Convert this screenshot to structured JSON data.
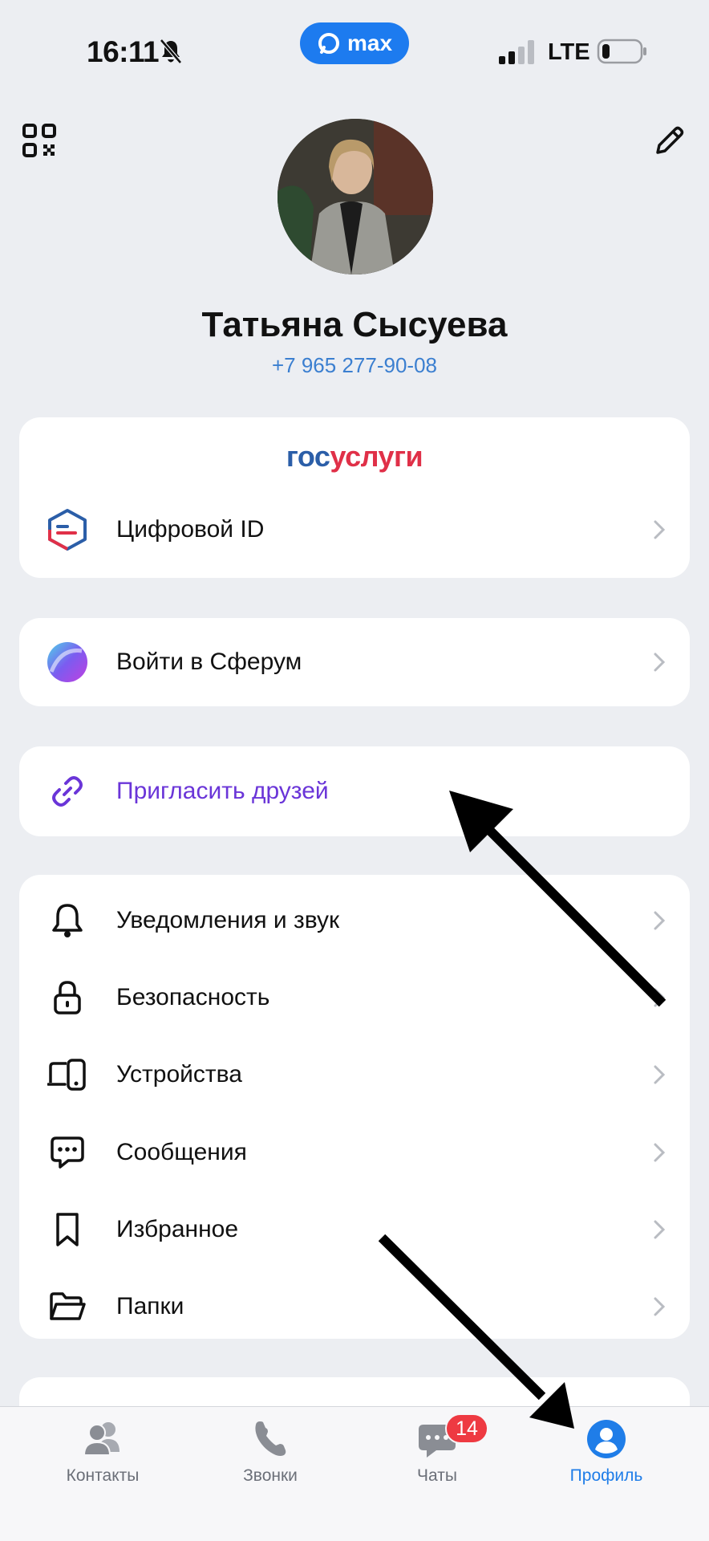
{
  "status_bar": {
    "time": "16:11",
    "app_pill_label": "max",
    "network": "LTE"
  },
  "profile": {
    "name": "Татьяна Сысуева",
    "phone": "+7 965 277-90-08"
  },
  "gosuslugi": {
    "logo_part1": "гос",
    "logo_part2": "услуги",
    "digital_id_label": "Цифровой ID"
  },
  "sferum": {
    "label": "Войти в Сферум"
  },
  "invite": {
    "label": "Пригласить друзей"
  },
  "settings": {
    "items": [
      {
        "label": "Уведомления и звук",
        "icon": "bell-icon"
      },
      {
        "label": "Безопасность",
        "icon": "lock-icon"
      },
      {
        "label": "Устройства",
        "icon": "devices-icon"
      },
      {
        "label": "Сообщения",
        "icon": "message-icon"
      },
      {
        "label": "Избранное",
        "icon": "bookmark-icon"
      },
      {
        "label": "Папки",
        "icon": "folder-icon"
      }
    ]
  },
  "tab_bar": {
    "tabs": [
      {
        "label": "Контакты",
        "icon": "contacts-icon"
      },
      {
        "label": "Звонки",
        "icon": "phone-icon"
      },
      {
        "label": "Чаты",
        "icon": "chat-icon",
        "badge": "14"
      },
      {
        "label": "Профиль",
        "icon": "profile-icon",
        "active": true
      }
    ]
  },
  "colors": {
    "accent": "#1f7de8",
    "invite": "#6a35d8",
    "badge": "#ee3a42",
    "background": "#eceef2"
  }
}
